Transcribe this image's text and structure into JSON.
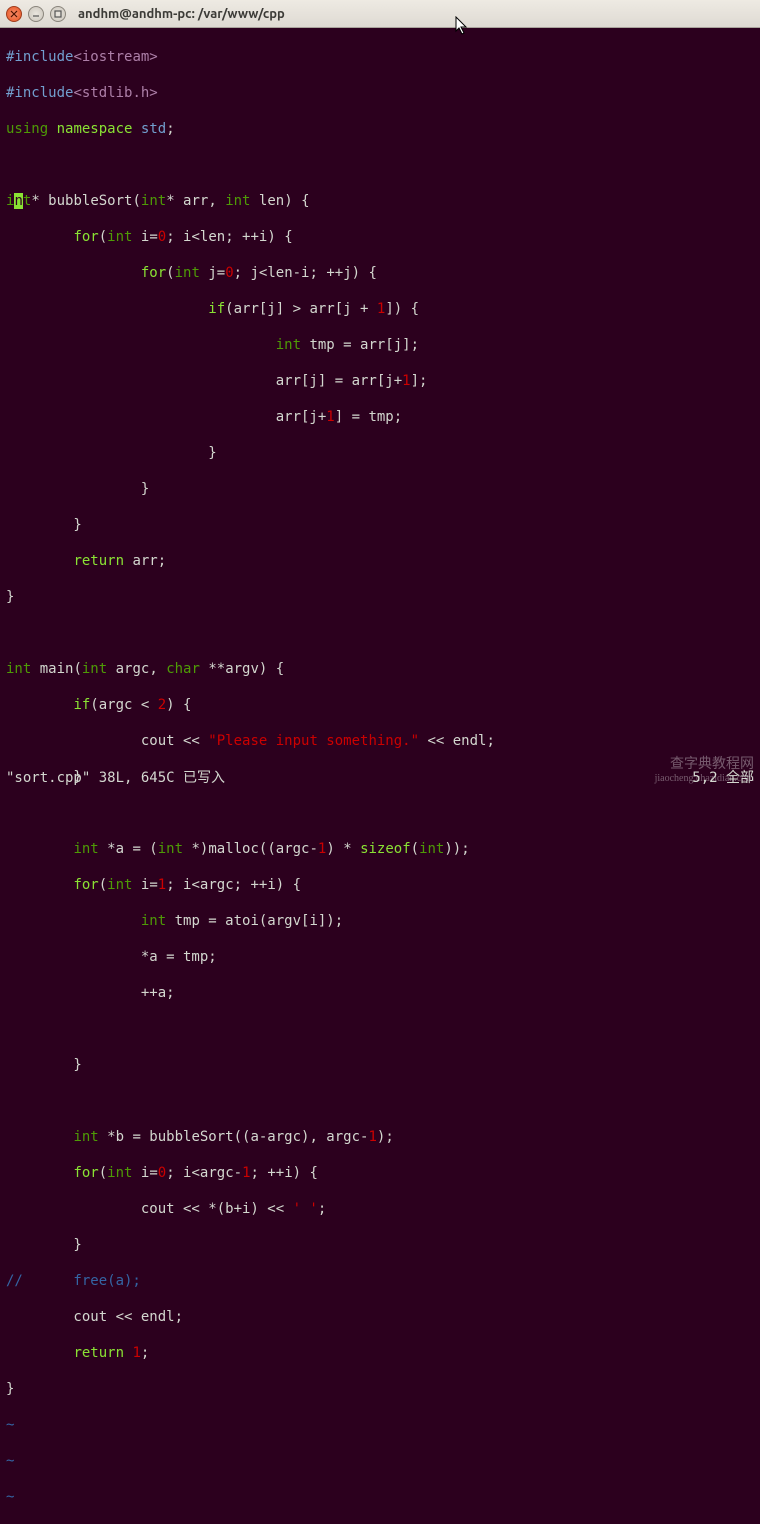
{
  "window": {
    "title": "andhm@andhm-pc: /var/www/cpp",
    "btn_close": "close",
    "btn_min": "minimize",
    "btn_max": "maximize"
  },
  "code": {
    "l1a": "#include",
    "l1b": "<iostream>",
    "l2a": "#include",
    "l2b": "<stdlib.h>",
    "l3a": "using",
    "l3b": "namespace",
    "l3c": "std",
    "l5_int": "int",
    "l5_ptr": "* bubbleSort(",
    "l5_int2": "int",
    "l5_args": "* arr, ",
    "l5_int3": "int",
    "l5_rest": " len) {",
    "l6a": "        ",
    "l6_for": "for",
    "l6_p": "(",
    "l6_int": "int",
    "l6_rest": " i=",
    "l6_n": "0",
    "l6_end": "; i<len; ++i) {",
    "l7a": "                ",
    "l7_for": "for",
    "l7_p": "(",
    "l7_int": "int",
    "l7_rest": " j=",
    "l7_n": "0",
    "l7_end": "; j<len-i; ++j) {",
    "l8a": "                        ",
    "l8_if": "if",
    "l8_rest": "(arr[j] > arr[j + ",
    "l8_n": "1",
    "l8_end": "]) {",
    "l9a": "                                ",
    "l9_int": "int",
    "l9_rest": " tmp = arr[j];",
    "l10a": "                                arr[j] = arr[j+",
    "l10_n": "1",
    "l10_end": "];",
    "l11a": "                                arr[j+",
    "l11_n": "1",
    "l11_end": "] = tmp;",
    "l12": "                        }",
    "l13": "                }",
    "l14": "        }",
    "l15a": "        ",
    "l15_ret": "return",
    "l15_rest": " arr;",
    "l16": "}",
    "l18_int": "int",
    "l18_a": " main(",
    "l18_int2": "int",
    "l18_b": " argc, ",
    "l18_char": "char",
    "l18_c": " **argv) {",
    "l19a": "        ",
    "l19_if": "if",
    "l19_rest": "(argc < ",
    "l19_n": "2",
    "l19_end": ") {",
    "l20a": "                cout << ",
    "l20_str": "\"Please input something.\"",
    "l20_end": " << endl;",
    "l21": "        }",
    "l23a": "        ",
    "l23_int": "int",
    "l23_b": " *a = (",
    "l23_int2": "int",
    "l23_c": " *)malloc((argc-",
    "l23_n": "1",
    "l23_d": ") * ",
    "l23_sz": "sizeof",
    "l23_e": "(",
    "l23_int3": "int",
    "l23_f": "));",
    "l24a": "        ",
    "l24_for": "for",
    "l24_p": "(",
    "l24_int": "int",
    "l24_rest": " i=",
    "l24_n": "1",
    "l24_end": "; i<argc; ++i) {",
    "l25a": "                ",
    "l25_int": "int",
    "l25_rest": " tmp = atoi(argv[i]);",
    "l26": "                *a = tmp;",
    "l27": "                ++a;",
    "l29": "        }",
    "l31a": "        ",
    "l31_int": "int",
    "l31_b": " *b = bubbleSort((a-argc), argc-",
    "l31_n": "1",
    "l31_c": ");",
    "l32a": "        ",
    "l32_for": "for",
    "l32_p": "(",
    "l32_int": "int",
    "l32_rest": " i=",
    "l32_n": "0",
    "l32_end": "; i<argc-",
    "l32_n2": "1",
    "l32_end2": "; ++i) {",
    "l33a": "                cout << *(b+i) << ",
    "l33_str": "' '",
    "l33_end": ";",
    "l34": "        }",
    "l35": "//      free(a);",
    "l36": "        cout << endl;",
    "l37a": "        ",
    "l37_ret": "return",
    "l37_sp": " ",
    "l37_n": "1",
    "l37_end": ";",
    "l38": "}",
    "tilde": "~"
  },
  "cursor": {
    "pre": "i",
    "at": "n",
    "post": "t"
  },
  "status": {
    "left": "\"sort.cpp\" 38L, 645C 已写入",
    "right": "5,2          全部"
  },
  "watermark": {
    "l1": "查字典教程网",
    "l2": "jiaocheng.chazidian.com"
  }
}
